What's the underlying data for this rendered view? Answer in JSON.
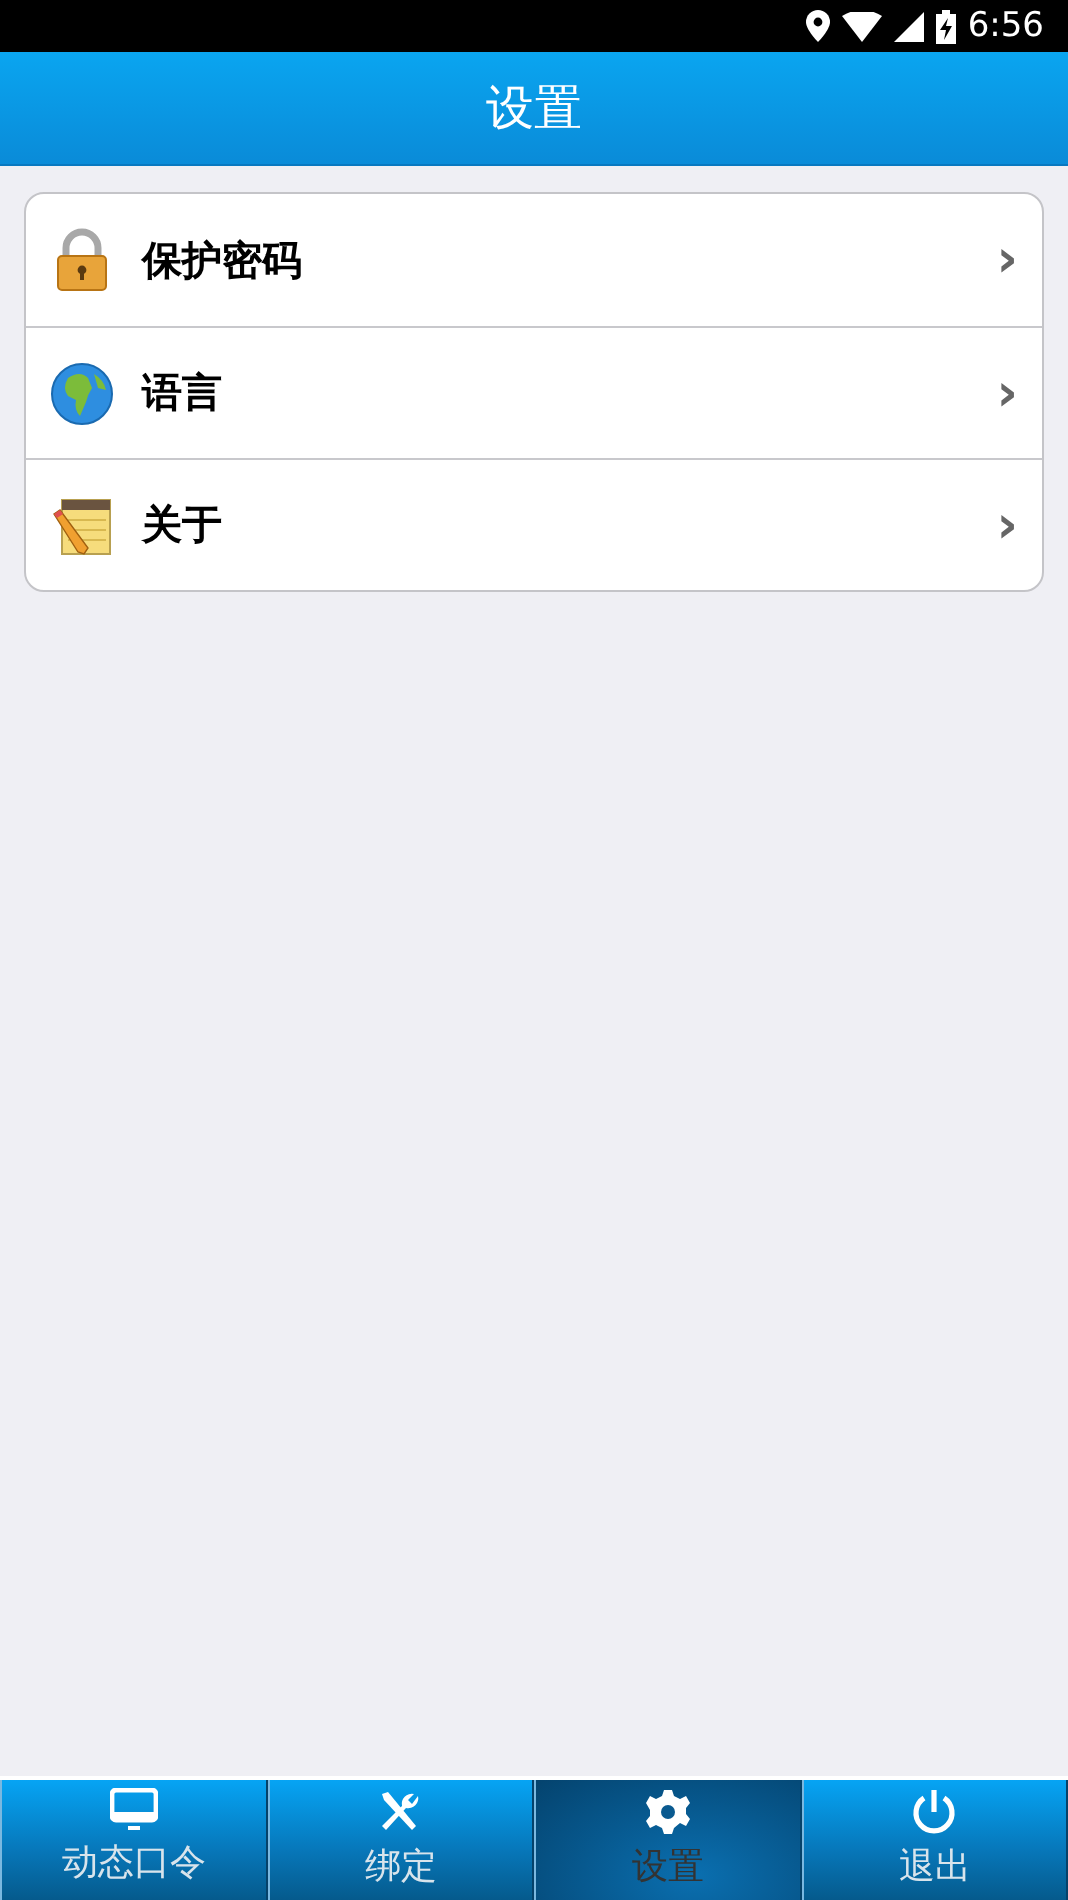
{
  "status_bar": {
    "time": "6:56"
  },
  "header": {
    "title": "设置"
  },
  "settings": [
    {
      "label": "保护密码",
      "chevron": "›"
    },
    {
      "label": "语言",
      "chevron": "›"
    },
    {
      "label": "关于",
      "chevron": "›"
    }
  ],
  "tabs": [
    {
      "label": "动态口令",
      "selected": false
    },
    {
      "label": "绑定",
      "selected": false
    },
    {
      "label": "设置",
      "selected": true
    },
    {
      "label": "退出",
      "selected": false
    }
  ]
}
